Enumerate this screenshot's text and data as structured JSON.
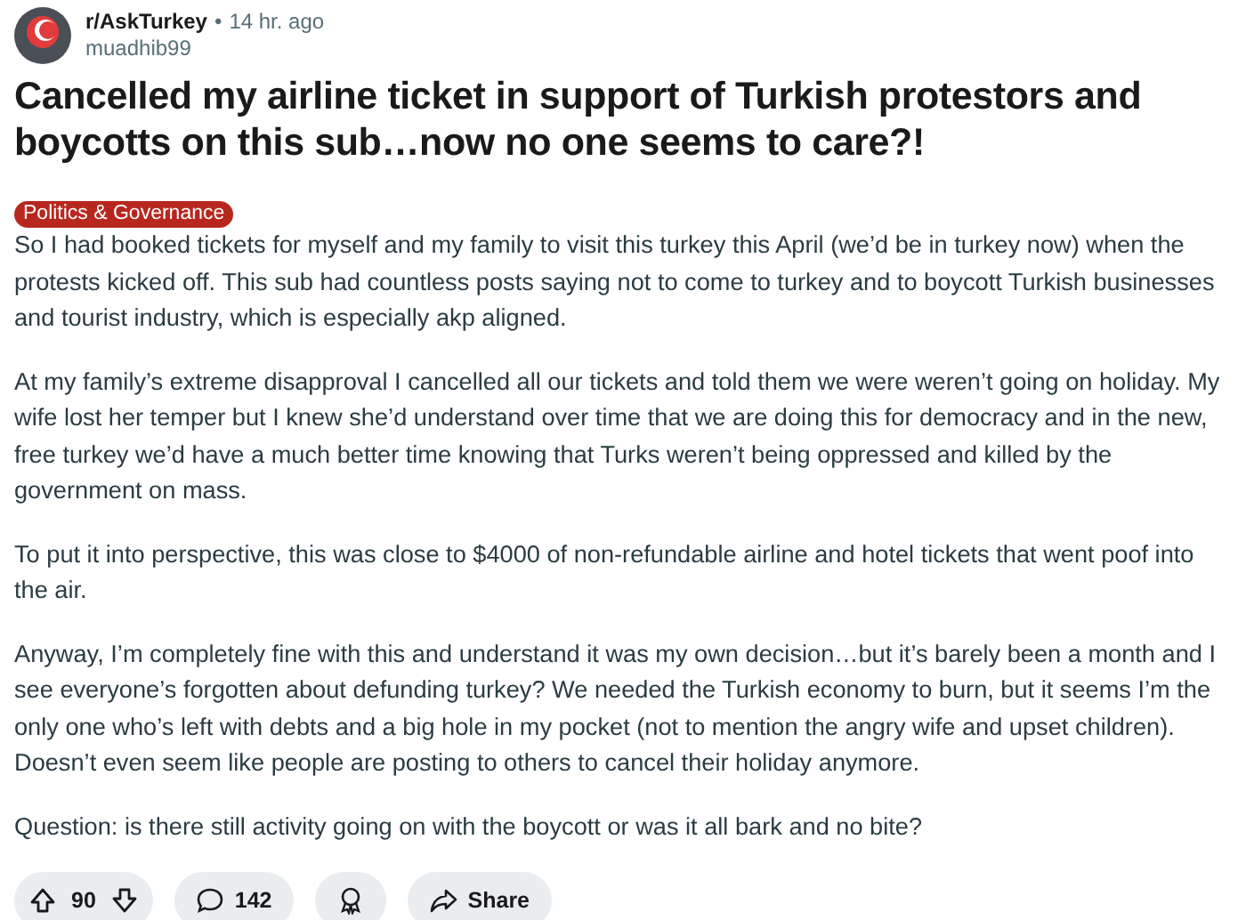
{
  "post": {
    "subreddit": "r/AskTurkey",
    "separator": "•",
    "time": "14 hr. ago",
    "author": "muadhib99",
    "title": "Cancelled my airline ticket in support of Turkish protestors and boycotts on this sub…now no one seems to care?!",
    "flair": {
      "label": "Politics & Governance",
      "color": "#b8271e"
    },
    "paragraphs": [
      "So I had booked tickets for myself and my family to visit this turkey this April (we’d be in turkey now) when the protests kicked off. This sub had countless posts saying not to come to turkey and to boycott Turkish businesses and tourist industry, which is especially akp aligned.",
      "At my family’s extreme disapproval I cancelled all our tickets and told them we were weren’t going on holiday. My wife lost her temper but I knew she’d understand over time that we are doing this for democracy and in the new, free turkey we’d have a much better time knowing that Turks weren’t being oppressed and killed by the government on mass.",
      "To put it into perspective, this was close to $4000 of non-refundable airline and hotel tickets that went poof into the air.",
      "Anyway, I’m completely fine with this and understand it was my own decision…but it’s barely been a month and I see everyone’s forgotten about defunding turkey? We needed the Turkish economy to burn, but it seems I’m the only one who’s left with debts and a big hole in my pocket (not to mention the angry wife and upset children). Doesn’t even seem like people are posting to others to cancel their holiday anymore.",
      "Question: is there still activity going on with the boycott or was it all bark and no bite?"
    ],
    "actions": {
      "votes": "90",
      "comments": "142",
      "share": "Share"
    }
  }
}
